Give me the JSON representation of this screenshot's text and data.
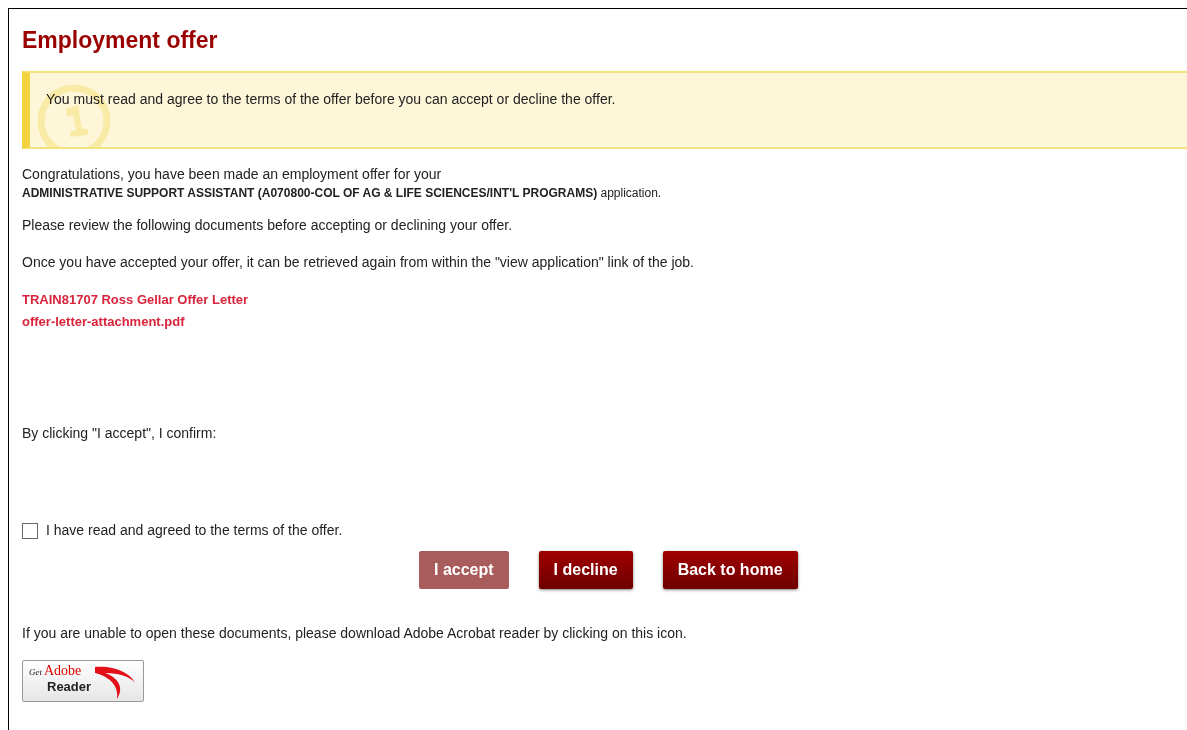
{
  "title": "Employment offer",
  "notice": "You must read and agree to the terms of the offer before you can accept or decline the offer.",
  "intro": "Congratulations, you have been made an employment offer for your",
  "position": "**ADMINISTRATIVE SUPPORT ASSISTANT (A070800-COL OF AG & LIFE SCIENCES/INT'L PROGRAMS)** application.",
  "review": "Please review the following documents before accepting or declining your offer.",
  "retrieve": "Once you have accepted your offer, it can be retrieved again from within the \"view application\" link of the job.",
  "documents": [
    "TRAIN81707 Ross Gellar Offer Letter",
    "offer-letter-attachment.pdf"
  ],
  "confirm_intro": "By clicking \"I accept\", I confirm:",
  "agreement": {
    "label": "I have read and agreed to the terms of the offer.",
    "checked": false
  },
  "buttons": [
    {
      "label": "I accept",
      "disabled": true
    },
    {
      "label": "I decline",
      "disabled": false
    },
    {
      "label": "Back to home",
      "disabled": false
    }
  ],
  "download_note": "If you are unable to open these documents, please download Adobe Acrobat reader by clicking on this icon.",
  "reader_badge": {
    "get": "Get",
    "brand": "Adobe",
    "product": "Reader"
  }
}
